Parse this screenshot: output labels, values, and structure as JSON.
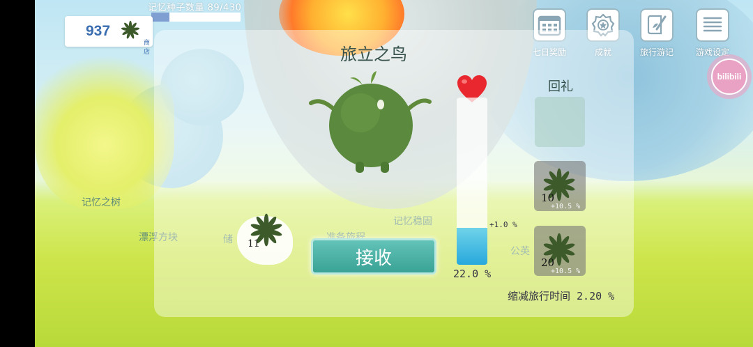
{
  "hud": {
    "memory_seed_label": "记忆种子数量 89/430",
    "memory_seed_fraction": 0.207,
    "coins": "937",
    "shop_label": "商店"
  },
  "top_menu": [
    {
      "label": "七日奖励",
      "icon": "calendar-icon"
    },
    {
      "label": "成就",
      "icon": "badge-icon"
    },
    {
      "label": "旅行游记",
      "icon": "journal-icon"
    },
    {
      "label": "游戏设定",
      "icon": "settings-list-icon"
    }
  ],
  "brand": {
    "label": "bilibili"
  },
  "scene_labels": {
    "tree": "记忆之树",
    "floating_block": "漂浮方块",
    "storage": "储",
    "prepare_trip": "准备旅程",
    "stone": "记忆稳固",
    "dandelion": "公英"
  },
  "dialog": {
    "title": "旅立之鸟",
    "receive_button": "接收",
    "gauge_percent": "22.0 %",
    "gauge_fraction": 0.22,
    "gauge_delta": "+1.0 %",
    "reward_title": "回礼",
    "rewards": [
      {
        "count": "10",
        "bonus": "+10.5 %"
      },
      {
        "count": "20",
        "bonus": "+10.5 %"
      }
    ],
    "held_seed_count": "11",
    "reduce_text": "缩减旅行时间 2.20 %"
  },
  "colors": {
    "accent_teal": "#3aa296",
    "coin_blue": "#3a6db0",
    "gauge_blue": "#28a8dc",
    "heart_red": "#e8282e"
  }
}
